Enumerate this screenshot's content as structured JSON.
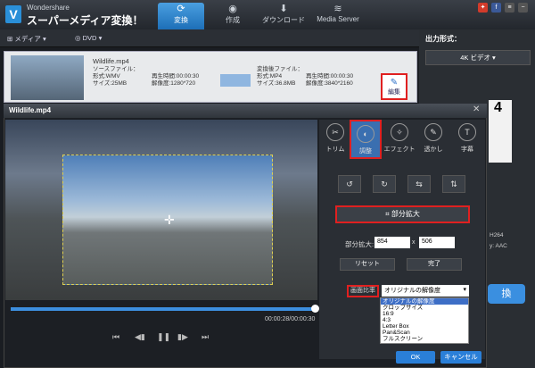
{
  "app": {
    "brand_small": "Wondershare",
    "brand_title": "スーパーメディア変換！"
  },
  "main_tabs": {
    "convert": "変換",
    "edit": "作成",
    "download": "ダウンロード",
    "media_server": "Media Server"
  },
  "toolbar": {
    "media": "メディア",
    "dvd": "DVD"
  },
  "output": {
    "label": "出力形式：",
    "format": "4K ビデオ"
  },
  "file": {
    "name": "Wildlife.mp4",
    "source_label": "ソースファイル：",
    "source_format": "形式:WMV",
    "source_size": "サイズ:25MB",
    "source_duration": "再生時間:00:00:30",
    "source_resolution": "解像度:1280*720",
    "dest_label": "変換後ファイル：",
    "dest_format": "形式:MP4",
    "dest_size": "サイズ:36.8MB",
    "dest_duration": "再生時間:00:00:30",
    "dest_resolution": "解像度:3840*2160",
    "edit_button": "編集"
  },
  "dialog": {
    "title": "Wildlife.mp4",
    "timecode": "00:00:28/00:00:30",
    "tabs": [
      "トリム",
      "調整",
      "エフェクト",
      "透かし",
      "字幕"
    ],
    "partial_zoom_button": "部分拡大",
    "zoom_label": "部分拡大:",
    "zoom_width": "854",
    "zoom_height": "506",
    "zoom_x": "x",
    "reset": "リセット",
    "done": "完了",
    "ratio_label": "画面比率",
    "ratio_selected": "オリジナルの解像度",
    "ratio_options": [
      "オリジナルの解像度",
      "クロップサイズ",
      "16:9",
      "4:3",
      "Letter Box",
      "Pan&Scan",
      "フルスクリーン"
    ],
    "ok": "OK",
    "cancel": "キャンセル"
  },
  "underlay": {
    "peek_number": "4",
    "h264": "H264",
    "aac": "y: AAC",
    "convert_fragment": "換"
  }
}
